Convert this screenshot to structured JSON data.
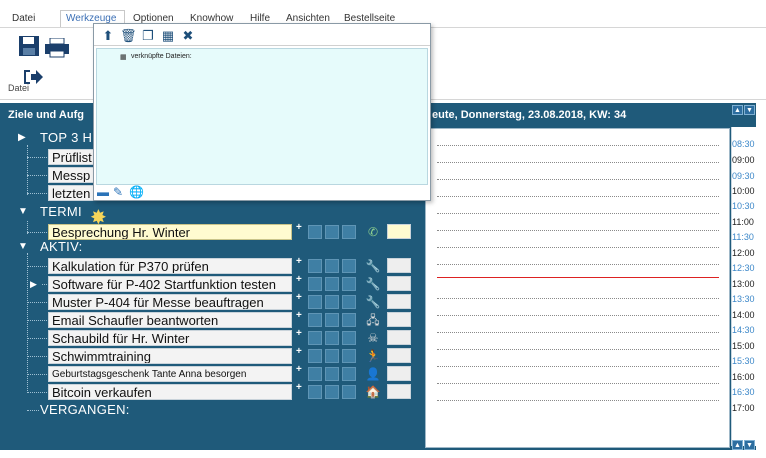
{
  "menu": {
    "items": [
      "Datei",
      "Werkzeuge",
      "Optionen",
      "Knowhow",
      "Hilfe",
      "Ansichten",
      "Bestellseite"
    ],
    "active": "Werkzeuge"
  },
  "ribbon": {
    "group_label": "Datei"
  },
  "left_panel": {
    "title": "Ziele und Aufg",
    "sections": {
      "top3": "TOP 3 H",
      "termine": "TERMI",
      "aktiv": "AKTIV:",
      "vergangen": "VERGANGEN:"
    },
    "top3_items": [
      "Prüflist",
      "Messp",
      "letzten"
    ],
    "termine_items": [
      "Besprechung Hr. Winter"
    ],
    "aktiv_items": [
      "Kalkulation für P370 prüfen",
      "Software für P-402 Startfunktion testen",
      "Muster P-404 für Messe beauftragen",
      "Email Schaufler beantworten",
      "Schaubild für Hr. Winter",
      "Schwimmtraining",
      "Geburtstagsgeschenk Tante Anna besorgen",
      "Bitcoin verkaufen"
    ],
    "plus": "+"
  },
  "day_view": {
    "header": "eute, Donnerstag, 23.08.2018, KW: 34",
    "times": [
      "08:30",
      "09:00",
      "09:30",
      "10:00",
      "10:30",
      "11:00",
      "11:30",
      "12:00",
      "12:30",
      "13:00",
      "13:30",
      "14:00",
      "14:30",
      "15:00",
      "15:30",
      "16:00",
      "16:30",
      "17:00"
    ]
  },
  "popup": {
    "label": "verknüpfte Dateien:"
  },
  "colors": {
    "panel_bg": "#1f5a7a",
    "half_hour": "#3d88c9",
    "current_time": "#d22222",
    "selected_task": "#fffbd0"
  }
}
